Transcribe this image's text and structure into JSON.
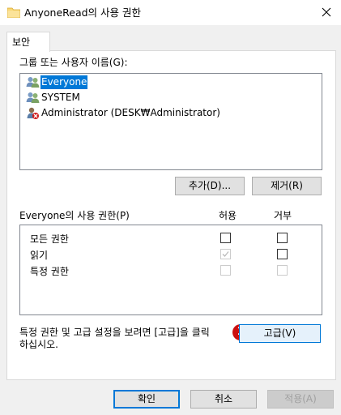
{
  "window": {
    "title": "AnyoneRead의 사용 권한",
    "close_glyph": "✕"
  },
  "tabs": [
    {
      "label": "보안",
      "active": true
    }
  ],
  "groups": {
    "label": "그룹 또는 사용자 이름(G):",
    "items": [
      {
        "name": "Everyone",
        "icon": "users-icon",
        "selected": true
      },
      {
        "name": "SYSTEM",
        "icon": "users-icon",
        "selected": false
      },
      {
        "name": "Administrator (DESK₩Administrator)",
        "icon": "user-blocked-icon",
        "selected": false
      }
    ]
  },
  "buttons": {
    "add": "추가(D)...",
    "remove": "제거(R)",
    "advanced": "고급(V)",
    "ok": "확인",
    "cancel": "취소",
    "apply": "적용(A)"
  },
  "permissions": {
    "label": "Everyone의 사용 권한(P)",
    "col_allow": "허용",
    "col_deny": "거부",
    "rows": [
      {
        "name": "모든 권한",
        "allow": false,
        "deny": false,
        "allow_disabled": false,
        "deny_disabled": false
      },
      {
        "name": "읽기",
        "allow": true,
        "deny": false,
        "allow_disabled": true,
        "deny_disabled": false
      },
      {
        "name": "특정 권한",
        "allow": false,
        "deny": false,
        "allow_disabled": true,
        "deny_disabled": true
      }
    ]
  },
  "advanced_hint": {
    "line1": "특정 권한 및 고급 설정을 보려면 [고급]을 클릭",
    "line2": "하십시오."
  },
  "annotation": {
    "number": "1",
    "color": "#cc1010"
  },
  "colors": {
    "selection": "#0078d7",
    "button_bg": "#e1e1e1",
    "button_border": "#adadad",
    "dialog_bg": "#f0f0f0"
  }
}
